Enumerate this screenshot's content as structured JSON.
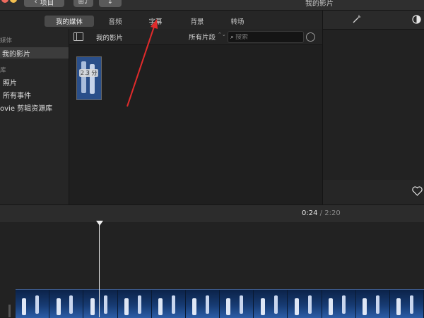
{
  "titlebar": {
    "back_label": "项目",
    "window_title": "我的影片",
    "media_btn": "⊞♪",
    "import_btn": "↓"
  },
  "tabs": [
    {
      "label": "我的媒体",
      "active": true
    },
    {
      "label": "音频",
      "active": false
    },
    {
      "label": "字幕",
      "active": false
    },
    {
      "label": "背景",
      "active": false
    },
    {
      "label": "转场",
      "active": false
    }
  ],
  "sidebar": {
    "section_media": "媒体",
    "my_movie": "我的影片",
    "section_library": "库",
    "photos": "照片",
    "all_events": "所有事件",
    "imovie_library": "ovie 剪辑资源库"
  },
  "browser": {
    "title": "我的影片",
    "filter_label": "所有片段",
    "filter_chevron": "⌃⌄",
    "search_placeholder": "搜索"
  },
  "clip": {
    "duration": "2.3 分"
  },
  "timeline": {
    "current": "0:24",
    "separator": "/",
    "total": "2:20"
  },
  "icons": {
    "magic_wand": "magic-wand-icon",
    "color": "color-balance-icon",
    "favorite": "heart-icon"
  },
  "colors": {
    "annotation_arrow": "#e02b2b",
    "active_tab": "#4a4a4a"
  }
}
